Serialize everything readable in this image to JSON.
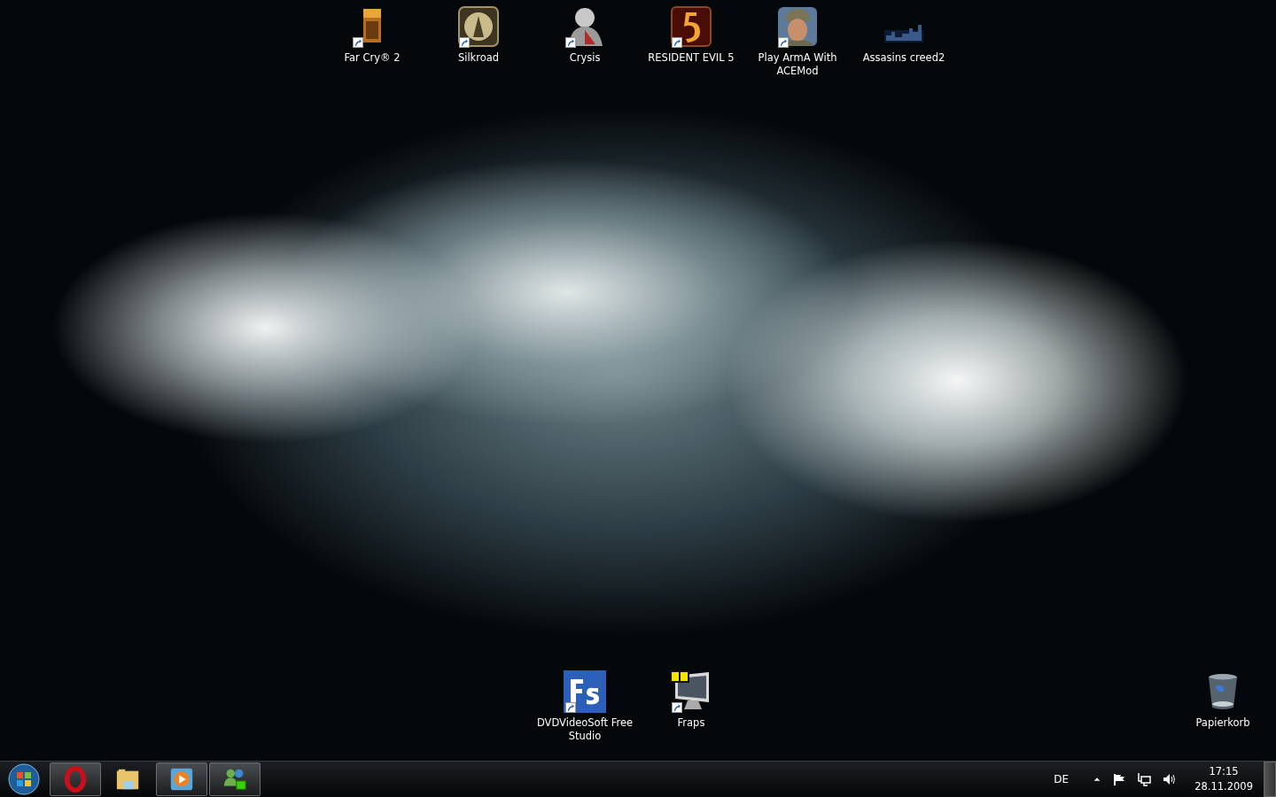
{
  "desktop": {
    "top_icons": [
      {
        "label": "Far Cry® 2",
        "kind": "game-box",
        "shortcut": true
      },
      {
        "label": "Silkroad",
        "kind": "medallion",
        "shortcut": true
      },
      {
        "label": "Crysis",
        "kind": "armor",
        "shortcut": true
      },
      {
        "label": "RESIDENT EVIL 5",
        "kind": "numeral",
        "shortcut": true
      },
      {
        "label": "Play ArmA With ACEMod",
        "kind": "soldier",
        "shortcut": true
      },
      {
        "label": "Assasins creed2",
        "kind": "skyline",
        "shortcut": false
      }
    ],
    "bottom_icons": [
      {
        "label": "DVDVideoSoft Free Studio",
        "kind": "fs-tile",
        "shortcut": true
      },
      {
        "label": "Fraps",
        "kind": "monitor",
        "shortcut": true
      }
    ],
    "recycle_bin": {
      "label": "Papierkorb"
    }
  },
  "taskbar": {
    "pinned": [
      {
        "kind": "opera",
        "running": true
      },
      {
        "kind": "folder",
        "running": false
      },
      {
        "kind": "media",
        "running": true
      },
      {
        "kind": "messenger",
        "running": true
      }
    ],
    "language": "DE",
    "time": "17:15",
    "date": "28.11.2009"
  }
}
